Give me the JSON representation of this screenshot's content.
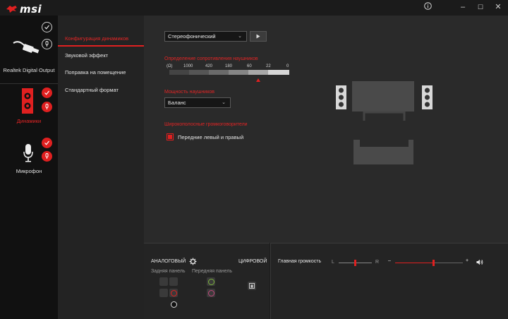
{
  "app": {
    "logo_text": "msi"
  },
  "titlebar": {
    "info_icon": "info-icon",
    "minimize": "–",
    "maximize": "☐",
    "close": "✕"
  },
  "devices": [
    {
      "label": "Realtek Digital Output",
      "icon": "digital-output-icon",
      "active": false
    },
    {
      "label": "Динамики",
      "icon": "speaker-icon",
      "active": true
    },
    {
      "label": "Микрофон",
      "icon": "microphone-icon",
      "active": false
    }
  ],
  "menu": {
    "items": [
      {
        "label": "Конфигурация динамиков",
        "active": true
      },
      {
        "label": "Звуковой эффект",
        "active": false
      },
      {
        "label": "Поправка на помещение",
        "active": false
      },
      {
        "label": "Стандартный формат",
        "active": false
      }
    ]
  },
  "config": {
    "speaker_mode": "Стереофонический",
    "impedance_label": "Определение сопротивления наушников",
    "impedance_unit": "(Ω)",
    "impedance_scale": [
      "1000",
      "420",
      "180",
      "60",
      "22",
      "0"
    ],
    "power_label": "Мощность наушников",
    "power_value": "Баланс",
    "fullrange_label": "Широкополосные громкоговорители",
    "fullrange_option": "Передние левый и правый",
    "fullrange_checked": true
  },
  "connectors": {
    "analog_label": "АНАЛОГОВЫЙ",
    "digital_label": "ЦИФРОВОЙ",
    "rear_panel_label": "Задняя панель",
    "front_panel_label": "Передняя панель"
  },
  "volume": {
    "label": "Главная громкость",
    "left": "L",
    "right": "R",
    "minus": "–",
    "plus": "+",
    "balance": 0.5,
    "level": 0.57
  },
  "colors": {
    "accent": "#e02020",
    "bg": "#1b1b1b"
  }
}
